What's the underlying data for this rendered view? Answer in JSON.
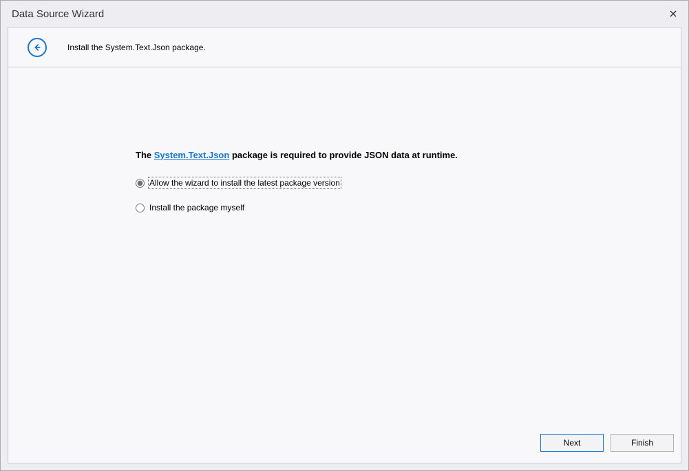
{
  "window": {
    "title": "Data Source Wizard"
  },
  "header": {
    "text": "Install the System.Text.Json package."
  },
  "main": {
    "message_prefix": "The ",
    "message_link": "System.Text.Json",
    "message_suffix": " package is required to provide JSON data at runtime.",
    "options": {
      "allow_install": "Allow the wizard to install the latest package version",
      "install_myself": "Install the package myself"
    }
  },
  "footer": {
    "next": "Next",
    "finish": "Finish"
  }
}
